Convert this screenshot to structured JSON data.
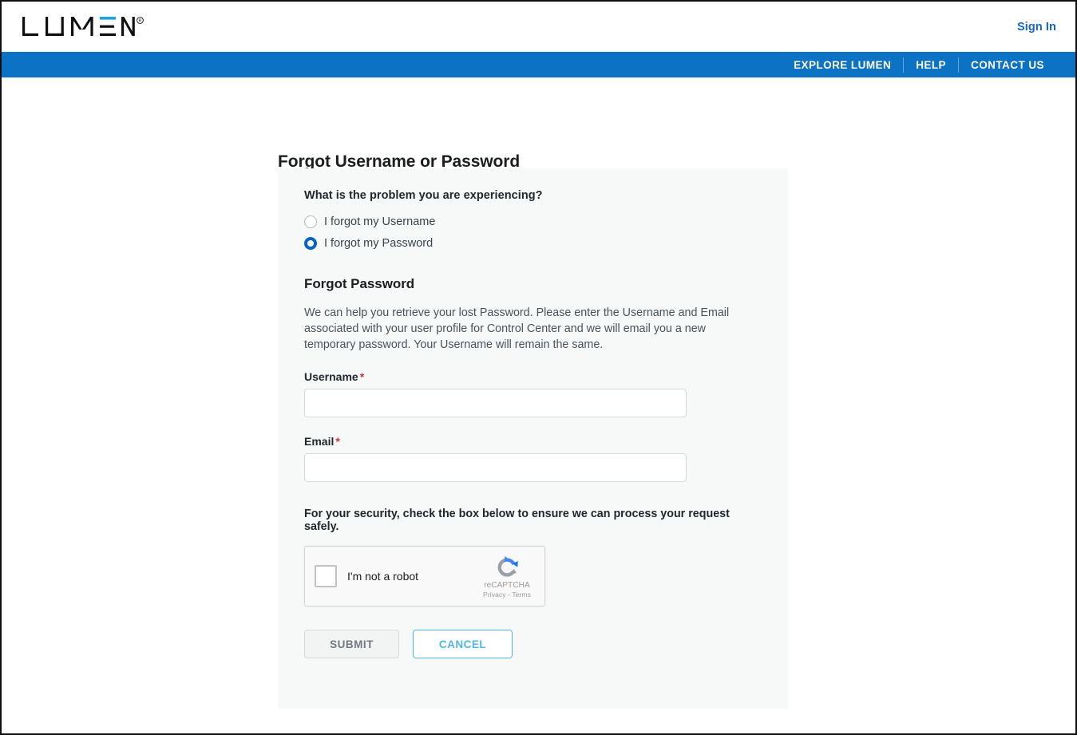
{
  "header": {
    "logo_text": "LUMEN",
    "logo_registered_mark": "®",
    "signin_label": "Sign In",
    "nav_links": [
      {
        "label": "EXPLORE LUMEN"
      },
      {
        "label": "HELP"
      },
      {
        "label": "CONTACT US"
      }
    ]
  },
  "colors": {
    "nav_bar_blue": "#0b72c4",
    "link_blue": "#1464c8",
    "logo_accent_blue": "#1ba3e0",
    "radio_selected_blue": "#0a62c2",
    "cancel_border_blue": "#4fb5e8",
    "required_red": "#d0323c",
    "panel_background": "#f7f9f9"
  },
  "page": {
    "title": "Forgot Username or Password"
  },
  "form": {
    "question_label": "What is the problem you are experiencing?",
    "options": [
      {
        "label": "I forgot my Username",
        "selected": false
      },
      {
        "label": "I forgot my Password",
        "selected": true
      }
    ],
    "section_title": "Forgot Password",
    "description": "We can help you retrieve your lost Password. Please enter the Username and Email associated with your user profile for Control Center and we will email you a new temporary password. Your Username will remain the same.",
    "fields": [
      {
        "label": "Username",
        "required_mark": "*",
        "value": "",
        "placeholder": ""
      },
      {
        "label": "Email",
        "required_mark": "*",
        "value": "",
        "placeholder": ""
      }
    ],
    "security_note": "For your security, check the box below to ensure we can process your request safely.",
    "captcha": {
      "checkbox_label": "I'm not a robot",
      "brand_name": "reCAPTCHA",
      "legal_text": "Privacy - Terms",
      "checked": false
    },
    "buttons": {
      "submit_label": "SUBMIT",
      "cancel_label": "CANCEL"
    }
  }
}
